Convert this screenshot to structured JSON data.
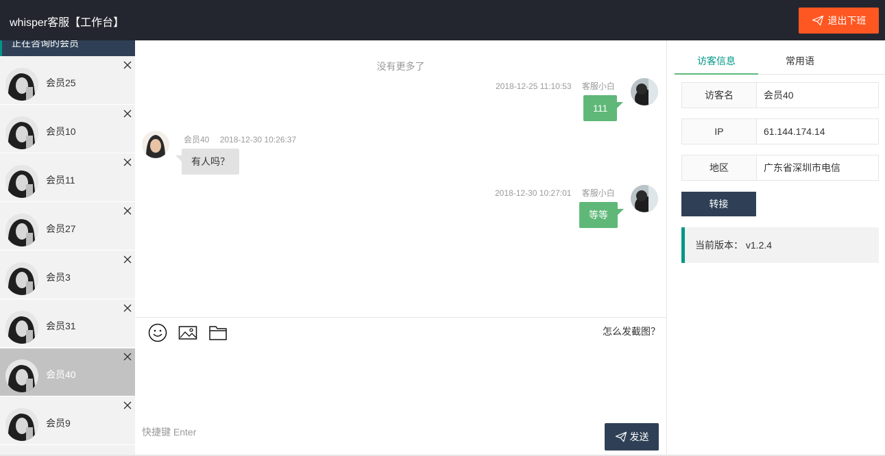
{
  "header": {
    "title": "whisper客服【工作台】",
    "logout_label": "退出下班",
    "accent": "#ff5722"
  },
  "sidebar": {
    "heading": "正在咨询的会员",
    "sessions": [
      {
        "name": "会员25",
        "active": false
      },
      {
        "name": "会员10",
        "active": false
      },
      {
        "name": "会员11",
        "active": false
      },
      {
        "name": "会员27",
        "active": false
      },
      {
        "name": "会员3",
        "active": false
      },
      {
        "name": "会员31",
        "active": false
      },
      {
        "name": "会员40",
        "active": true
      },
      {
        "name": "会员9",
        "active": false
      }
    ]
  },
  "chat": {
    "no_more": "没有更多了",
    "messages": [
      {
        "from": "agent",
        "sender": "客服小白",
        "time": "2018-12-25 11:10:53",
        "text": "111"
      },
      {
        "from": "visitor",
        "sender": "会员40",
        "time": "2018-12-30 10:26:37",
        "text": "有人吗？"
      },
      {
        "from": "agent",
        "sender": "客服小白",
        "time": "2018-12-30 10:27:01",
        "text": "等等"
      }
    ],
    "tools": [
      "smiley-icon",
      "image-icon",
      "folder-icon"
    ],
    "help_link": "怎么发截图？",
    "input_value": "",
    "shortcut_hint": "快捷键 Enter",
    "send_label": "发送"
  },
  "right": {
    "tabs": [
      {
        "label": "访客信息",
        "active": true
      },
      {
        "label": "常用语",
        "active": false
      }
    ],
    "info": [
      {
        "key": "访客名",
        "value": "会员40"
      },
      {
        "key": "IP",
        "value": "61.144.174.14"
      },
      {
        "key": "地区",
        "value": "广东省深圳市电信"
      }
    ],
    "transfer_label": "转接",
    "version_label": "当前版本：",
    "version_value": "v1.2.4"
  }
}
